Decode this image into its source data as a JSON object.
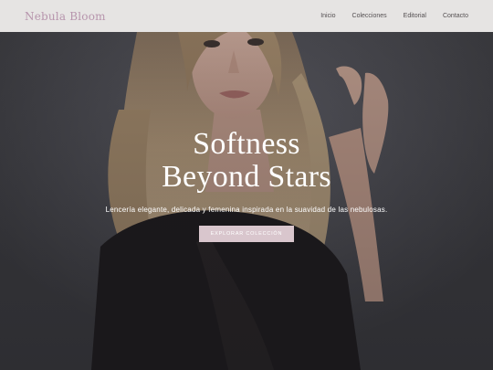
{
  "navbar": {
    "brand": "Nebula Bloom",
    "links": [
      {
        "label": "Inicio"
      },
      {
        "label": "Colecciones"
      },
      {
        "label": "Editorial"
      },
      {
        "label": "Contacto"
      }
    ],
    "background": "#e6e4e3",
    "brand_color": "#b795ad"
  },
  "hero": {
    "title_line1": "Softness",
    "title_line2": "Beyond Stars",
    "subtitle": "Lencería elegante, delicada y femenina inspirada en la suavidad de las nebulosas.",
    "cta_label": "EXPLORAR COLECCIÓN",
    "cta_color": "#d9c6cd",
    "image_subject": "portrait of a woman with long blonde hair in dark top"
  }
}
